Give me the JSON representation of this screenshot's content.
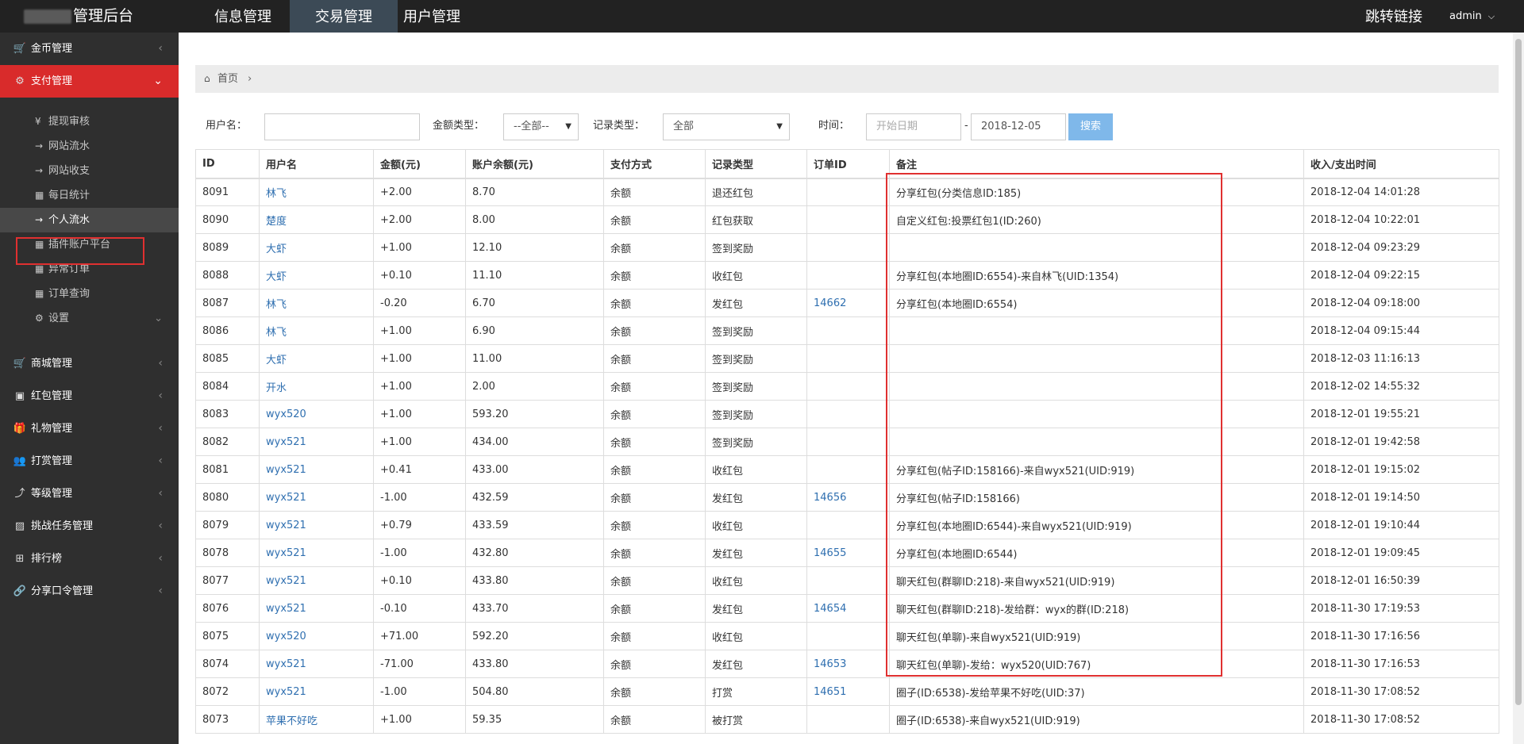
{
  "topbar": {
    "brand_title": "管理后台",
    "nav": [
      {
        "label": "信息管理"
      },
      {
        "label": "交易管理",
        "active": true
      },
      {
        "label": "用户管理"
      }
    ],
    "jump_link": "跳转链接",
    "user": "admin"
  },
  "sidebar": {
    "menus": [
      {
        "label": "金币管理",
        "icon": "cart-icon",
        "glyph": "🛒"
      },
      {
        "label": "支付管理",
        "icon": "gears-icon",
        "glyph": "⚙",
        "active": true
      },
      {
        "label": "商城管理",
        "icon": "cart-icon",
        "glyph": "🛒"
      },
      {
        "label": "红包管理",
        "icon": "briefcase-icon",
        "glyph": "▣"
      },
      {
        "label": "礼物管理",
        "icon": "gift-icon",
        "glyph": "🎁"
      },
      {
        "label": "打赏管理",
        "icon": "users-icon",
        "glyph": "👥"
      },
      {
        "label": "等级管理",
        "icon": "level-up-icon",
        "glyph": "⤴"
      },
      {
        "label": "挑战任务管理",
        "icon": "picture-icon",
        "glyph": "▨"
      },
      {
        "label": "排行榜",
        "icon": "sitemap-icon",
        "glyph": "⊞"
      },
      {
        "label": "分享口令管理",
        "icon": "link-icon",
        "glyph": "🔗"
      }
    ],
    "submenu": [
      {
        "label": "提现审核",
        "icon": "yen-icon",
        "glyph": "¥"
      },
      {
        "label": "网站流水",
        "icon": "arrow-right-icon",
        "glyph": "→"
      },
      {
        "label": "网站收支",
        "icon": "arrow-right-icon",
        "glyph": "→"
      },
      {
        "label": "每日统计",
        "icon": "grid-icon",
        "glyph": "▦"
      },
      {
        "label": "个人流水",
        "icon": "arrow-right-icon",
        "glyph": "→",
        "active": true
      },
      {
        "label": "插件账户平台",
        "icon": "grid-icon",
        "glyph": "▦"
      },
      {
        "label": "异常订单",
        "icon": "grid-icon",
        "glyph": "▦"
      },
      {
        "label": "订单查询",
        "icon": "grid-icon",
        "glyph": "▦"
      },
      {
        "label": "设置",
        "icon": "gear-icon",
        "glyph": "⚙"
      }
    ]
  },
  "breadcrumb": {
    "home": "首页",
    "separator": "›"
  },
  "filters": {
    "username_label": "用户名：",
    "username_value": "",
    "amount_type_label": "金额类型：",
    "amount_type_value": "--全部--",
    "record_type_label": "记录类型：",
    "record_type_value": "全部",
    "time_label": "时间：",
    "start_placeholder": "开始日期",
    "dash": "-",
    "end_value": "2018-12-05",
    "search_label": "搜索"
  },
  "table": {
    "columns": [
      "ID",
      "用户名",
      "金额(元)",
      "账户余额(元)",
      "支付方式",
      "记录类型",
      "订单ID",
      "备注",
      "收入/支出时间"
    ],
    "rows": [
      [
        "8091",
        "林飞",
        "+2.00",
        "8.70",
        "余额",
        "退还红包",
        "",
        "分享红包(分类信息ID:185)",
        "2018-12-04 14:01:28"
      ],
      [
        "8090",
        "楚度",
        "+2.00",
        "8.00",
        "余额",
        "红包获取",
        "",
        "自定义红包:投票红包1(ID:260)",
        "2018-12-04 10:22:01"
      ],
      [
        "8089",
        "大虾",
        "+1.00",
        "12.10",
        "余额",
        "签到奖励",
        "",
        "",
        "2018-12-04 09:23:29"
      ],
      [
        "8088",
        "大虾",
        "+0.10",
        "11.10",
        "余额",
        "收红包",
        "",
        "分享红包(本地圈ID:6554)-来自林飞(UID:1354)",
        "2018-12-04 09:22:15"
      ],
      [
        "8087",
        "林飞",
        "-0.20",
        "6.70",
        "余额",
        "发红包",
        "14662",
        "分享红包(本地圈ID:6554)",
        "2018-12-04 09:18:00"
      ],
      [
        "8086",
        "林飞",
        "+1.00",
        "6.90",
        "余额",
        "签到奖励",
        "",
        "",
        "2018-12-04 09:15:44"
      ],
      [
        "8085",
        "大虾",
        "+1.00",
        "11.00",
        "余额",
        "签到奖励",
        "",
        "",
        "2018-12-03 11:16:13"
      ],
      [
        "8084",
        "开水",
        "+1.00",
        "2.00",
        "余额",
        "签到奖励",
        "",
        "",
        "2018-12-02 14:55:32"
      ],
      [
        "8083",
        "wyx520",
        "+1.00",
        "593.20",
        "余额",
        "签到奖励",
        "",
        "",
        "2018-12-01 19:55:21"
      ],
      [
        "8082",
        "wyx521",
        "+1.00",
        "434.00",
        "余额",
        "签到奖励",
        "",
        "",
        "2018-12-01 19:42:58"
      ],
      [
        "8081",
        "wyx521",
        "+0.41",
        "433.00",
        "余额",
        "收红包",
        "",
        "分享红包(帖子ID:158166)-来自wyx521(UID:919)",
        "2018-12-01 19:15:02"
      ],
      [
        "8080",
        "wyx521",
        "-1.00",
        "432.59",
        "余额",
        "发红包",
        "14656",
        "分享红包(帖子ID:158166)",
        "2018-12-01 19:14:50"
      ],
      [
        "8079",
        "wyx521",
        "+0.79",
        "433.59",
        "余额",
        "收红包",
        "",
        "分享红包(本地圈ID:6544)-来自wyx521(UID:919)",
        "2018-12-01 19:10:44"
      ],
      [
        "8078",
        "wyx521",
        "-1.00",
        "432.80",
        "余额",
        "发红包",
        "14655",
        "分享红包(本地圈ID:6544)",
        "2018-12-01 19:09:45"
      ],
      [
        "8077",
        "wyx521",
        "+0.10",
        "433.80",
        "余额",
        "收红包",
        "",
        "聊天红包(群聊ID:218)-来自wyx521(UID:919)",
        "2018-12-01 16:50:39"
      ],
      [
        "8076",
        "wyx521",
        "-0.10",
        "433.70",
        "余额",
        "发红包",
        "14654",
        "聊天红包(群聊ID:218)-发给群：wyx的群(ID:218)",
        "2018-11-30 17:19:53"
      ],
      [
        "8075",
        "wyx520",
        "+71.00",
        "592.20",
        "余额",
        "收红包",
        "",
        "聊天红包(单聊)-来自wyx521(UID:919)",
        "2018-11-30 17:16:56"
      ],
      [
        "8074",
        "wyx521",
        "-71.00",
        "433.80",
        "余额",
        "发红包",
        "14653",
        "聊天红包(单聊)-发给：wyx520(UID:767)",
        "2018-11-30 17:16:53"
      ],
      [
        "8072",
        "wyx521",
        "-1.00",
        "504.80",
        "余额",
        "打赏",
        "14651",
        "圈子(ID:6538)-发给苹果不好吃(UID:37)",
        "2018-11-30 17:08:52"
      ],
      [
        "8073",
        "苹果不好吃",
        "+1.00",
        "59.35",
        "余额",
        "被打赏",
        "",
        "圈子(ID:6538)-来自wyx521(UID:919)",
        "2018-11-30 17:08:52"
      ]
    ]
  },
  "colors": {
    "topbar": "#222222",
    "sidebar": "#2f2f2f",
    "active_menu": "#d92b2b",
    "link": "#2f6fb0",
    "search_button": "#7fb8ea",
    "annotation_box": "#e03030"
  }
}
